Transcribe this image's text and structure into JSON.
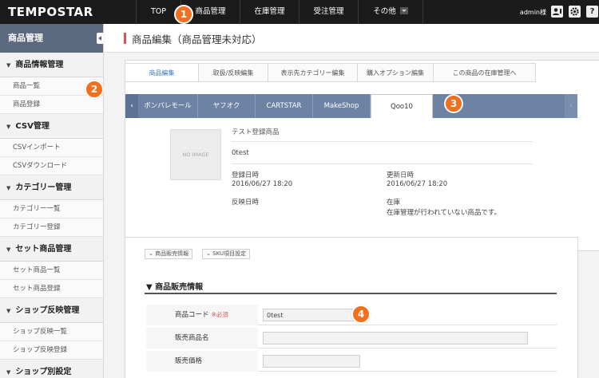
{
  "app": {
    "logo": "TEMPOSTAR",
    "nav": [
      {
        "label": "TOP"
      },
      {
        "label": "商品管理"
      },
      {
        "label": "在庫管理"
      },
      {
        "label": "受注管理"
      },
      {
        "label": "その他"
      }
    ],
    "admin": "admin様",
    "tools": {
      "help_label": "?"
    }
  },
  "badges": [
    "1",
    "2",
    "3",
    "4"
  ],
  "sidebar": {
    "title": "商品管理",
    "groups": [
      {
        "label": "商品情報管理",
        "items": [
          "商品一覧",
          "商品登録"
        ]
      },
      {
        "label": "CSV管理",
        "items": [
          "CSVインポート",
          "CSVダウンロード"
        ]
      },
      {
        "label": "カテゴリー管理",
        "items": [
          "カテゴリー一覧",
          "カテゴリー登録"
        ]
      },
      {
        "label": "セット商品管理",
        "items": [
          "セット商品一覧",
          "セット商品登録"
        ]
      },
      {
        "label": "ショップ反映管理",
        "items": [
          "ショップ反映一覧",
          "ショップ反映登録"
        ]
      },
      {
        "label": "ショップ別設定",
        "items": []
      }
    ]
  },
  "page": {
    "title": "商品編集（商品管理未対応）",
    "subtabs": [
      "商品編集",
      "取扱/反映編集",
      "表示先カテゴリー編集",
      "購入オプション編集",
      "この商品の在庫管理へ"
    ],
    "shoptabs": {
      "left_arrow": "‹",
      "right_arrow": "›",
      "items": [
        "ボンパレモール",
        "ヤフオク",
        "CARTSTAR",
        "MakeShop",
        "Qoo10"
      ]
    },
    "product": {
      "no_image": "NO IMAGE",
      "name": "テスト登録商品",
      "code": "0test",
      "registered_label": "登録日時",
      "registered_value": "2016/06/27 18:20",
      "updated_label": "更新日時",
      "updated_value": "2016/06/27 18:20",
      "reflected_label": "反映日時",
      "stock_label": "在庫",
      "stock_value": "在庫管理が行われていない商品です。"
    },
    "buttons": [
      "商品販売情報",
      "SKU項目設定"
    ],
    "section_title": "▼ 商品販売情報",
    "form": [
      {
        "label": "商品コード",
        "required": "※必須",
        "value": "0test"
      },
      {
        "label": "販売商品名",
        "required": "",
        "value": ""
      },
      {
        "label": "販売価格",
        "required": "",
        "value": ""
      }
    ]
  },
  "colors": {
    "topbar": "#1b1b1b",
    "badge": "#f0701e",
    "sidebar_head": "#5b6980",
    "shop_tabs": "#6c83a4",
    "accent": "#e0524b"
  }
}
